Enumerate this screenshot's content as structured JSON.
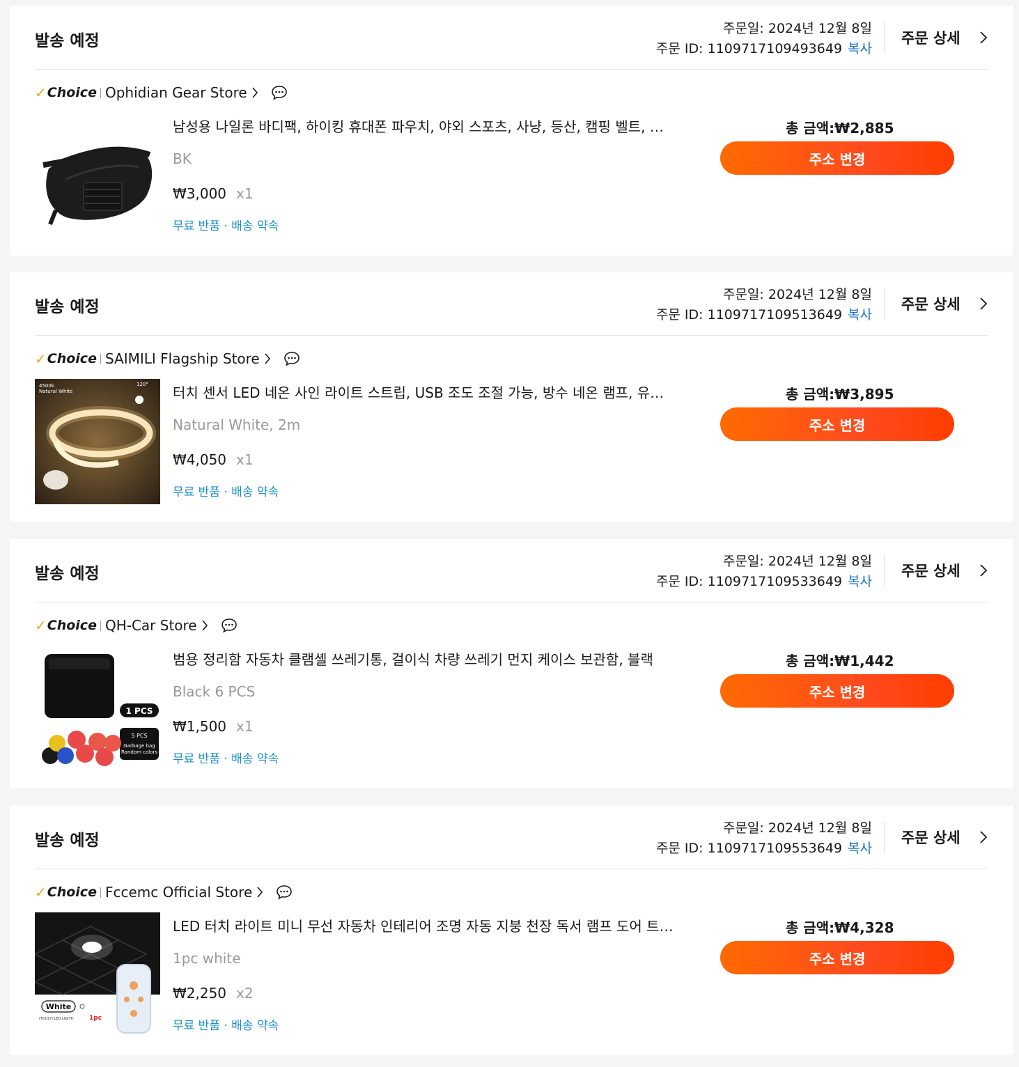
{
  "orders": [
    {
      "status": "발송 예정",
      "order_date": "주문일: 2024년 12월 8일",
      "order_id": "주문 ID: 1109717109493649",
      "copy_label": "복사",
      "detail_label": "주문 상세",
      "choice_label": "Choice",
      "store_name": "Ophidian Gear Store",
      "product_title": "남성용 나일론 바디팩, 하이킹 휴대폰 파우치, 야외 스포츠, 사냥, 등산, 캠핑 벨트, 허리 가방",
      "variant": "BK",
      "price": "₩3,000",
      "quantity": "x1",
      "perks": "무료 반품 · 배송 약속",
      "total": "총 금액:₩2,885",
      "action_label": "주소 변경",
      "thumb_icon": "waist-bag-image"
    },
    {
      "status": "발송 예정",
      "order_date": "주문일: 2024년 12월 8일",
      "order_id": "주문 ID: 1109717109513649",
      "copy_label": "복사",
      "detail_label": "주문 상세",
      "choice_label": "Choice",
      "store_name": "SAIMILI Flagship Store",
      "product_title": "터치 센서 LED 네온 사인 라이트 스트립, USB 조도 조절 가능, 방수 네온 램프, 유연한 조명",
      "variant": "Natural White, 2m",
      "price": "₩4,050",
      "quantity": "x1",
      "perks": "무료 반품 · 배송 약속",
      "total": "총 금액:₩3,895",
      "action_label": "주소 변경",
      "thumb_icon": "led-strip-image",
      "thumb_text": [
        "4500k",
        "Natural White",
        "120°"
      ]
    },
    {
      "status": "발송 예정",
      "order_date": "주문일: 2024년 12월 8일",
      "order_id": "주문 ID: 1109717109533649",
      "copy_label": "복사",
      "detail_label": "주문 상세",
      "choice_label": "Choice",
      "store_name": "QH-Car Store",
      "product_title": "범용 정리함 자동차 클램셸 쓰레기통, 걸이식 차량 쓰레기 먼지 케이스 보관함, 블랙",
      "variant": "Black 6 PCS",
      "price": "₩1,500",
      "quantity": "x1",
      "perks": "무료 반품 · 배송 약속",
      "total": "총 금액:₩1,442",
      "action_label": "주소 변경",
      "thumb_icon": "car-trash-bin-image",
      "thumb_text": [
        "1 PCS",
        "5 PCS",
        "Garbage bag",
        "Random colors"
      ]
    },
    {
      "status": "발송 예정",
      "order_date": "주문일: 2024년 12월 8일",
      "order_id": "주문 ID: 1109717109553649",
      "copy_label": "복사",
      "detail_label": "주문 상세",
      "choice_label": "Choice",
      "store_name": "Fccemc Official Store",
      "product_title": "LED 터치 라이트 미니 무선 자동차 인테리어 조명 자동 지붕 천장 독서 램프 도어 트렁크",
      "variant": "1pc white",
      "price": "₩2,250",
      "quantity": "x2",
      "perks": "무료 반품 · 배송 약속",
      "total": "총 금액:₩4,328",
      "action_label": "주소 변경",
      "thumb_icon": "touch-led-light-image",
      "thumb_text": [
        "White",
        "(TOUCH LED LIGHT)",
        "1pc"
      ]
    }
  ],
  "colors": {
    "accent": "#ff4b1f",
    "link": "#1a73c9",
    "perk": "#1a8ec9",
    "choice_check": "#f7a21b"
  }
}
